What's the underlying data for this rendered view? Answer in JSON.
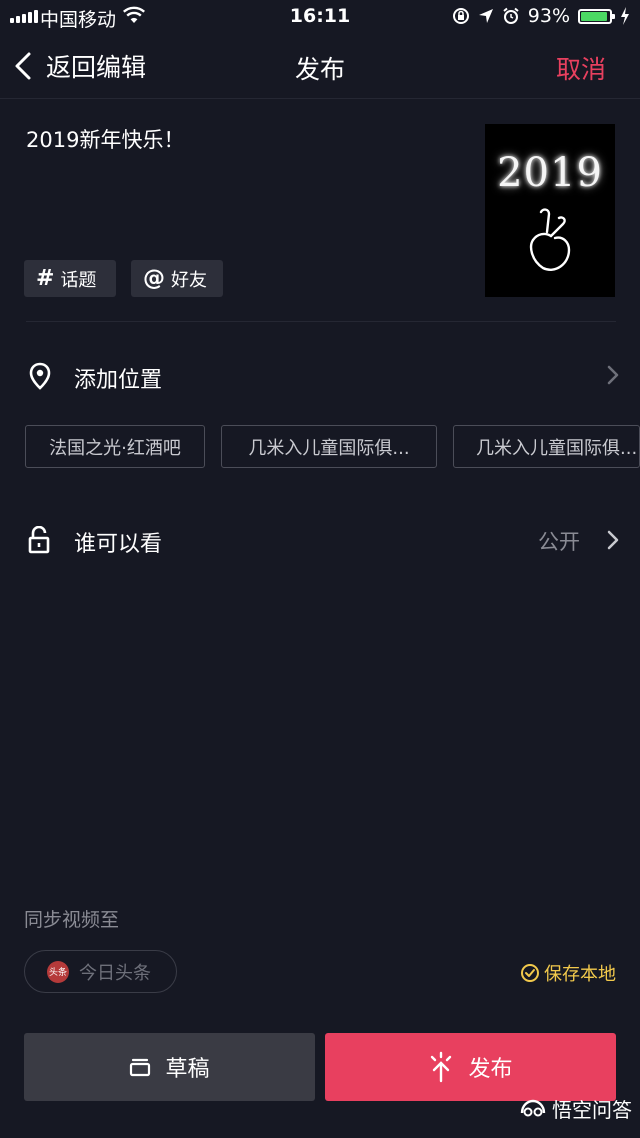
{
  "status_bar": {
    "carrier": "中国移动",
    "time": "16:11",
    "battery_percent": "93%",
    "battery_level": 0.93
  },
  "nav": {
    "back_label": "返回编辑",
    "title": "发布",
    "cancel_label": "取消"
  },
  "post": {
    "caption": "2019新年快乐！",
    "topic_chip": "话题",
    "friend_chip": "好友",
    "thumbnail_text": "2019"
  },
  "location": {
    "label": "添加位置",
    "suggestions": [
      "法国之光·红酒吧",
      "几米入儿童国际俱...",
      "几米入儿童国际俱..."
    ]
  },
  "privacy": {
    "label": "谁可以看",
    "value": "公开"
  },
  "sync": {
    "label": "同步视频至",
    "toutiao": "今日头条",
    "toutiao_logo_text": "头条",
    "save_local": "保存本地"
  },
  "actions": {
    "draft": "草稿",
    "publish": "发布"
  },
  "watermark": "悟空问答",
  "colors": {
    "background": "#161823",
    "accent": "#e8405f",
    "save_local": "#f2c94c",
    "battery_fill": "#4cd964"
  }
}
